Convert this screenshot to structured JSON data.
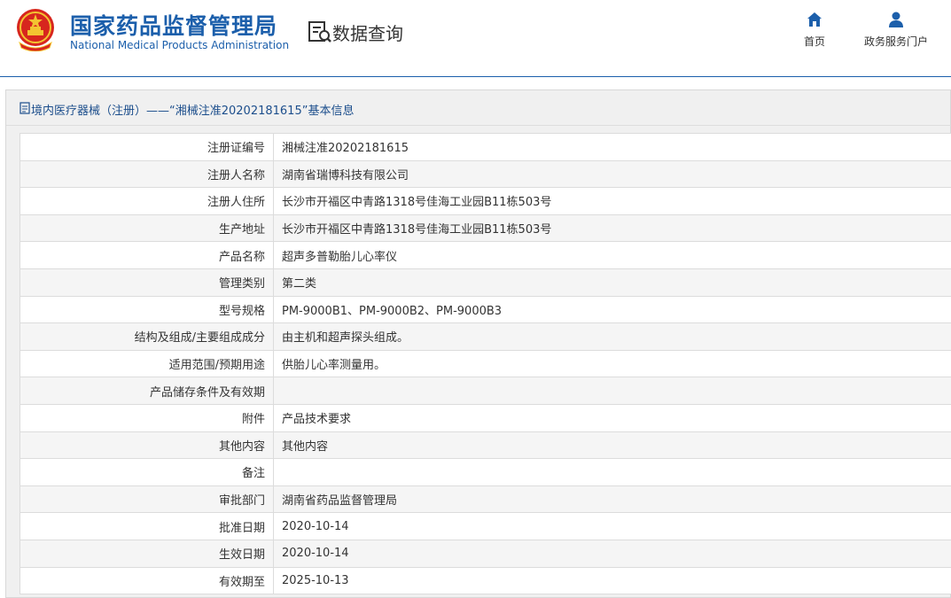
{
  "header": {
    "title_cn": "国家药品监督管理局",
    "title_en": "National Medical Products Administration",
    "query_title": "数据查询",
    "emblem_icon": "national-emblem-icon"
  },
  "nav": {
    "home": {
      "label": "首页",
      "icon": "home-icon"
    },
    "service": {
      "label": "政务服务门户",
      "icon": "user-icon"
    }
  },
  "breadcrumb": {
    "text": "境内医疗器械（注册）——“湘械注准20202181615”基本信息",
    "icon": "document-icon"
  },
  "colors": {
    "brand_blue": "#1c5fab",
    "breadcrumb_blue": "#1c4e8c"
  },
  "rows": [
    {
      "label": "注册证编号",
      "value": "湘械注准20202181615"
    },
    {
      "label": "注册人名称",
      "value": "湖南省瑞博科技有限公司"
    },
    {
      "label": "注册人住所",
      "value": "长沙市开福区中青路1318号佳海工业园B11栋503号"
    },
    {
      "label": "生产地址",
      "value": "长沙市开福区中青路1318号佳海工业园B11栋503号"
    },
    {
      "label": "产品名称",
      "value": "超声多普勒胎儿心率仪"
    },
    {
      "label": "管理类别",
      "value": "第二类"
    },
    {
      "label": "型号规格",
      "value": "PM-9000B1、PM-9000B2、PM-9000B3"
    },
    {
      "label": "结构及组成/主要组成成分",
      "value": "由主机和超声探头组成。"
    },
    {
      "label": "适用范围/预期用途",
      "value": "供胎儿心率测量用。"
    },
    {
      "label": "产品储存条件及有效期",
      "value": ""
    },
    {
      "label": "附件",
      "value": "产品技术要求"
    },
    {
      "label": "其他内容",
      "value": "其他内容"
    },
    {
      "label": "备注",
      "value": ""
    },
    {
      "label": "审批部门",
      "value": "湖南省药品监督管理局"
    },
    {
      "label": "批准日期",
      "value": "2020-10-14"
    },
    {
      "label": "生效日期",
      "value": "2020-10-14"
    },
    {
      "label": "有效期至",
      "value": "2025-10-13"
    }
  ]
}
